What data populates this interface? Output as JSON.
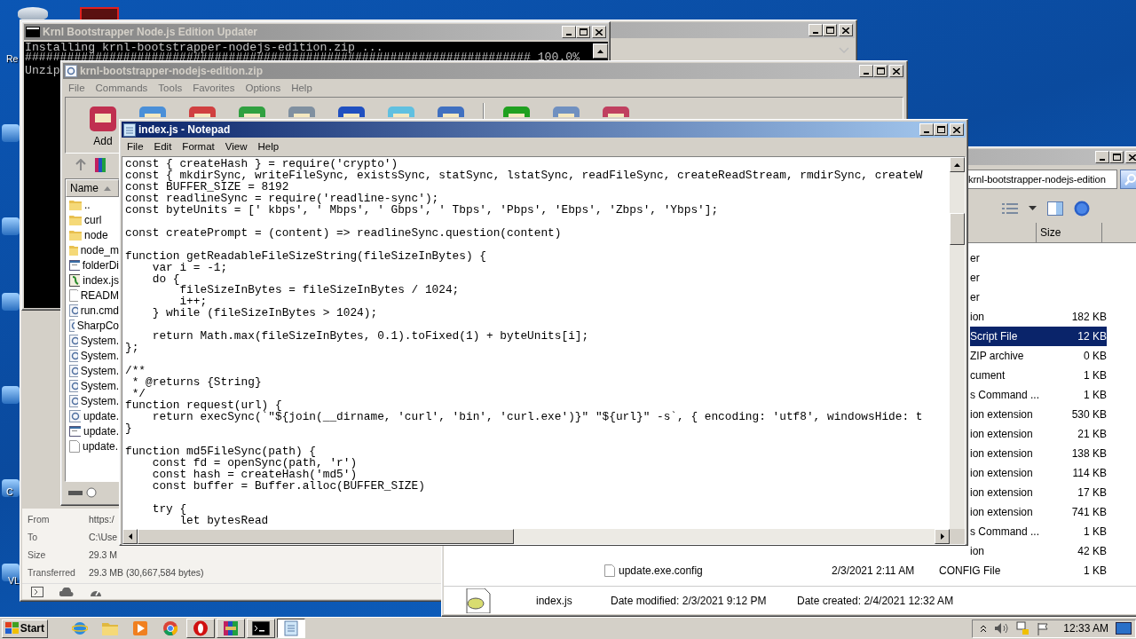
{
  "desktop": {
    "icon_labels": [
      "Re",
      "C",
      "VL"
    ]
  },
  "download_window": {
    "info": [
      {
        "label": "From",
        "value": "https:/"
      },
      {
        "label": "To",
        "value": "C:\\Use"
      },
      {
        "label": "Size",
        "value": "29.3 M"
      },
      {
        "label": "Transferred",
        "value": "29.3 MB (30,667,584 bytes)"
      }
    ]
  },
  "console_window": {
    "title": "Krnl Bootstrapper Node.js Edition Updater",
    "lines": [
      "Installing krnl-bootstrapper-nodejs-edition.zip ...",
      "######################################################################## 100.0%",
      "Unzip"
    ]
  },
  "explorer_window": {
    "address": "krnl-bootstrapper-nodejs-edition",
    "size_header": "Size",
    "rows": [
      {
        "kind": "cut",
        "type": "er",
        "selected": false
      },
      {
        "kind": "cut",
        "type": "er",
        "selected": false
      },
      {
        "kind": "cut",
        "type": "er",
        "selected": false
      },
      {
        "kind": "cut",
        "type": "ion",
        "size": "182 KB",
        "selected": false
      },
      {
        "kind": "cut",
        "type": "Script File",
        "size": "12 KB",
        "selected": true
      },
      {
        "kind": "cut",
        "type": "ZIP archive",
        "size": "0 KB",
        "selected": false
      },
      {
        "kind": "cut",
        "type": "cument",
        "size": "1 KB",
        "selected": false
      },
      {
        "kind": "cut",
        "type": "s Command ...",
        "size": "1 KB",
        "selected": false
      },
      {
        "kind": "cut",
        "type": "ion extension",
        "size": "530 KB",
        "selected": false
      },
      {
        "kind": "cut",
        "type": "ion extension",
        "size": "21 KB",
        "selected": false
      },
      {
        "kind": "cut",
        "type": "ion extension",
        "size": "138 KB",
        "selected": false
      },
      {
        "kind": "cut",
        "type": "ion extension",
        "size": "114 KB",
        "selected": false
      },
      {
        "kind": "cut",
        "type": "ion extension",
        "size": "17 KB",
        "selected": false
      },
      {
        "kind": "cut",
        "type": "ion extension",
        "size": "741 KB",
        "selected": false
      },
      {
        "kind": "cut",
        "type": "s Command ...",
        "size": "1 KB",
        "selected": false
      },
      {
        "kind": "cut",
        "type": "ion",
        "size": "42 KB",
        "selected": false
      },
      {
        "kind": "full",
        "name": "update.exe.config",
        "date": "2/3/2021 2:11 AM",
        "type": "CONFIG File",
        "size": "1 KB",
        "selected": false
      }
    ],
    "details": {
      "name": "index.js",
      "modified": "Date modified: 2/3/2021 9:12 PM",
      "created": "Date created: 2/4/2021 12:32 AM"
    }
  },
  "archive_window": {
    "title": "krnl-bootstrapper-nodejs-edition.zip",
    "menu": [
      "File",
      "Commands",
      "Tools",
      "Favorites",
      "Options",
      "Help"
    ],
    "add_label": "Add",
    "name_header": "Name",
    "files": [
      {
        "name": "..",
        "kind": "folder"
      },
      {
        "name": "curl",
        "kind": "folder"
      },
      {
        "name": "node",
        "kind": "folder"
      },
      {
        "name": "node_m",
        "kind": "folder"
      },
      {
        "name": "folderDi",
        "kind": "window"
      },
      {
        "name": "index.js",
        "kind": "script"
      },
      {
        "name": "READM",
        "kind": "text"
      },
      {
        "name": "run.cmd",
        "kind": "gear"
      },
      {
        "name": "SharpCo",
        "kind": "gear"
      },
      {
        "name": "System.",
        "kind": "gear"
      },
      {
        "name": "System.",
        "kind": "gear"
      },
      {
        "name": "System.",
        "kind": "gear"
      },
      {
        "name": "System.",
        "kind": "gear"
      },
      {
        "name": "System.",
        "kind": "gear"
      },
      {
        "name": "update.",
        "kind": "gear"
      },
      {
        "name": "update.",
        "kind": "window"
      },
      {
        "name": "update.",
        "kind": "text"
      }
    ]
  },
  "notepad": {
    "title": "index.js - Notepad",
    "menu": [
      "File",
      "Edit",
      "Format",
      "View",
      "Help"
    ],
    "text": "const { createHash } = require('crypto')\nconst { mkdirSync, writeFileSync, existsSync, statSync, lstatSync, readFileSync, createReadStream, rmdirSync, createW\nconst BUFFER_SIZE = 8192\nconst readlineSync = require('readline-sync');\nconst byteUnits = [' kbps', ' Mbps', ' Gbps', ' Tbps', 'Pbps', 'Ebps', 'Zbps', 'Ybps'];\n\nconst createPrompt = (content) => readlineSync.question(content)\n\nfunction getReadableFileSizeString(fileSizeInBytes) {\n    var i = -1;\n    do {\n        fileSizeInBytes = fileSizeInBytes / 1024;\n        i++;\n    } while (fileSizeInBytes > 1024);\n\n    return Math.max(fileSizeInBytes, 0.1).toFixed(1) + byteUnits[i];\n};\n\n/**\n * @returns {String}\n */\nfunction request(url) {\n    return execSync(`\"${join(__dirname, 'curl', 'bin', 'curl.exe')}\" \"${url}\" -s`, { encoding: 'utf8', windowsHide: t\n}\n\nfunction md5FileSync(path) {\n    const fd = openSync(path, 'r')\n    const hash = createHash('md5')\n    const buffer = Buffer.alloc(BUFFER_SIZE)\n\n    try {\n        let bytesRead"
  },
  "taskbar": {
    "start": "Start",
    "apps": [
      {
        "kind": "browser",
        "open": false,
        "selected": false
      },
      {
        "kind": "folder",
        "open": false,
        "selected": false
      },
      {
        "kind": "player",
        "open": false,
        "selected": false
      },
      {
        "kind": "chrome",
        "open": false,
        "selected": false
      },
      {
        "kind": "opera",
        "open": true,
        "selected": false
      },
      {
        "kind": "archive",
        "open": true,
        "selected": false
      },
      {
        "kind": "console",
        "open": true,
        "selected": false
      },
      {
        "kind": "notepad",
        "open": true,
        "selected": true
      }
    ],
    "clock": "12:33 AM"
  }
}
